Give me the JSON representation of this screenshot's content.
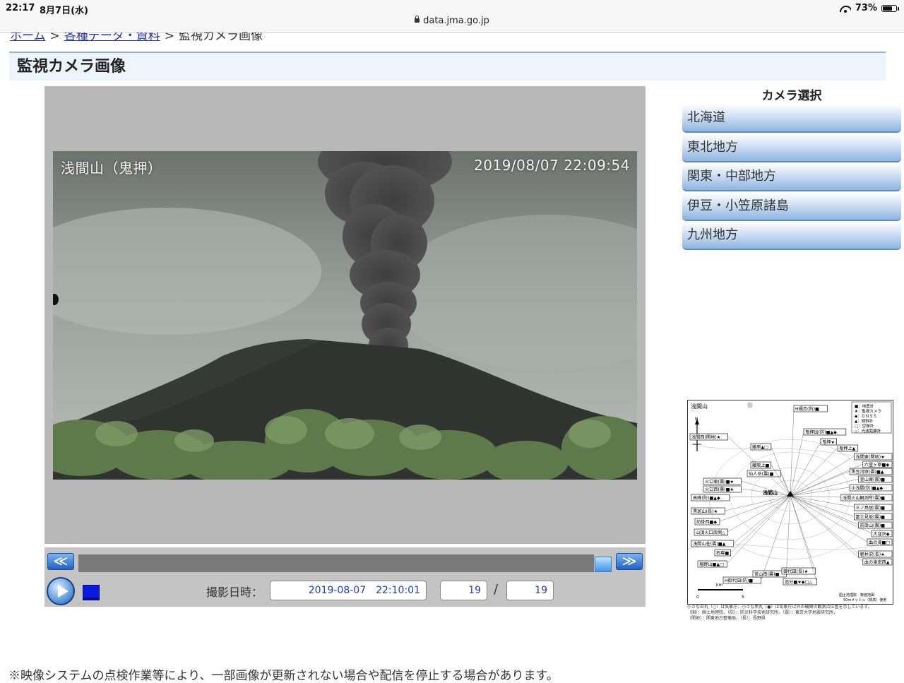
{
  "status_bar": {
    "time": "22:17",
    "date": "8月7日(水)",
    "url": "data.jma.go.jp",
    "battery": "73%",
    "battery_level": 0.73
  },
  "breadcrumb": {
    "home": "ホーム",
    "data": "各種データ・資料",
    "current": "監視カメラ画像",
    "separator": ">"
  },
  "page_title": "監視カメラ画像",
  "camera": {
    "name": "浅間山（鬼押）",
    "timestamp": "2019/08/07 22:09:54"
  },
  "controls": {
    "prev_label": "≪",
    "next_label": "≫",
    "date_label": "撮影日時：",
    "date_value": "2019-08-07　22:10:01",
    "frame_index": "19",
    "frame_total": "19",
    "slash": "/"
  },
  "camera_select": {
    "title": "カメラ選択",
    "regions": [
      "北海道",
      "東北地方",
      "関東・中部地方",
      "伊豆・小笠原諸島",
      "九州地方"
    ]
  },
  "map": {
    "title": "浅間山",
    "center_label": "浅間山",
    "north_label": "N",
    "scale_unit": "km",
    "scale_0": "0",
    "scale_5": "5",
    "legend": [
      "■：地震計",
      "★：監視カメラ",
      "◆：ＧＮＳＳ",
      "▲：傾斜計",
      "□：空振計",
      "△：光波距離計"
    ],
    "stations_left": [
      "浅間西(関地)★",
      "藤原▲□",
      "藤原上■",
      "仙人岳(震)■",
      "火口東(震)■★",
      "火口西(震)■★",
      "高峰(防)■▲◆",
      "黒斑山(長)★",
      "前掛西■◆",
      "山頂火口南側△",
      "浅間山荘(震)■▲",
      "石尊■",
      "塩野山■▲□",
      "H御代田(防)■",
      "釜山南(震)■",
      "追分■★◆□△",
      "御代田(長)★"
    ],
    "stations_right": [
      "H嬬恋(防)■",
      "鬼押出(防)■▲◆",
      "鬼押★",
      "鬼押上▲",
      "浅間東(関地)★",
      "六里ヶ原■◆",
      "黒豆河原(震)■▲",
      "釜山東(震)■",
      "小浅間(防)■▲◆",
      "浅間火山観測所(震)■",
      "三ノ鳥居(震)■",
      "富士見坂(震)■",
      "前掛山(震)■",
      "大窪沢◆",
      "血の滝■□",
      "軽井沢(長)★",
      "血の滝南西▲"
    ],
    "credit_1": "国土地理院　数値地図",
    "credit_2": "50mメッシュ（標高）使用",
    "caption_1": "小さな白丸（○）は気象庁、小さな黒丸（●）は気象庁以外の機関の観測点位置を示しています。",
    "caption_2": "（国）：国土地理院、（防）：防災科学技術研究所、（震）：東京大学地震研究所、",
    "caption_3": "（関地）：関東地方整備局、（長）：長野県"
  },
  "footer_note": "※映像システムの点検作業等により、一部画像が更新されない場合や配信を停止する場合があります。"
}
